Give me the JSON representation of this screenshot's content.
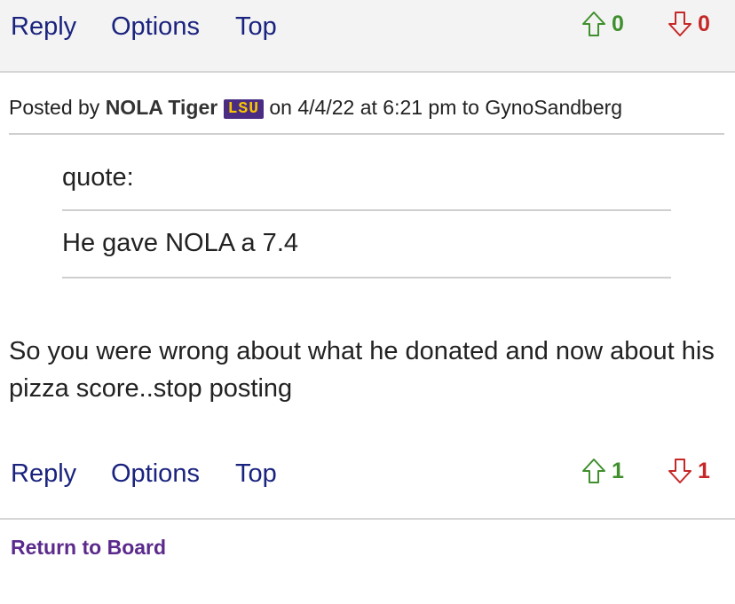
{
  "top_bar": {
    "reply_label": "Reply",
    "options_label": "Options",
    "top_label": "Top",
    "upvotes": "0",
    "downvotes": "0"
  },
  "post": {
    "posted_by_prefix": "Posted by",
    "author": "NOLA Tiger",
    "team_badge": "LSU",
    "on_text": "on 4/4/22 at 6:21 pm to GynoSandberg",
    "quote_label": "quote:",
    "quote_text": "He gave NOLA a 7.4",
    "body_text": "So you were wrong about what he donated and now about his pizza score..stop posting"
  },
  "bottom_bar": {
    "reply_label": "Reply",
    "options_label": "Options",
    "top_label": "Top",
    "upvotes": "1",
    "downvotes": "1"
  },
  "footer": {
    "return_label": "Return to Board"
  },
  "colors": {
    "link": "#1a237e",
    "upvote": "#3f8f2d",
    "downvote": "#c62828",
    "return_link": "#5b2a8c",
    "lsu_purple": "#4a2c82",
    "lsu_gold": "#f7c500"
  }
}
